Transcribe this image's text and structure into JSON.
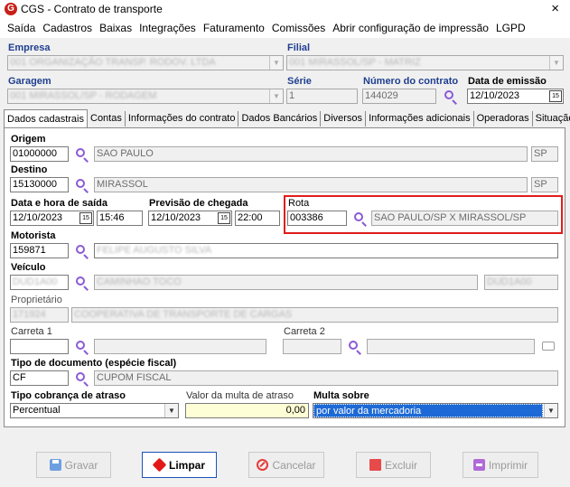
{
  "window": {
    "title": "CGS - Contrato de transporte",
    "close_glyph": "×",
    "logo_letter": "G"
  },
  "menu": [
    "Saída",
    "Cadastros",
    "Baixas",
    "Integrações",
    "Faturamento",
    "Comissões",
    "Abrir configuração de impressão",
    "LGPD"
  ],
  "header": {
    "empresa_label": "Empresa",
    "empresa_value": "001 ORGANIZAÇÃO TRANSP. RODOV. LTDA",
    "filial_label": "Filial",
    "filial_value": "001 MIRASSOL/SP - MATRIZ",
    "garagem_label": "Garagem",
    "garagem_value": "001 MIRASSOL/SP - RODAGEM",
    "serie_label": "Série",
    "serie_value": "1",
    "numero_label": "Número do contrato",
    "numero_value": "144029",
    "emissao_label": "Data de emissão",
    "emissao_value": "12/10/2023"
  },
  "tabs": [
    "Dados cadastrais",
    "Contas",
    "Informações do contrato",
    "Dados Bancários",
    "Diversos",
    "Informações adicionais",
    "Operadoras",
    "Situação"
  ],
  "form": {
    "origem_label": "Origem",
    "origem_code": "01000000",
    "origem_city": "SAO PAULO",
    "origem_uf": "SP",
    "destino_label": "Destino",
    "destino_code": "15130000",
    "destino_city": "MIRASSOL",
    "destino_uf": "SP",
    "saida_label": "Data e hora de saída",
    "saida_date": "12/10/2023",
    "saida_time": "15:46",
    "chegada_label": "Previsão de chegada",
    "chegada_date": "12/10/2023",
    "chegada_time": "22:00",
    "rota_label": "Rota",
    "rota_code": "003386",
    "rota_desc": "SAO PAULO/SP X MIRASSOL/SP",
    "motorista_label": "Motorista",
    "motorista_code": "159871",
    "motorista_name": "FELIPE AUGUSTO SILVA",
    "veiculo_label": "Veículo",
    "veiculo_plate": "DUD1A00",
    "veiculo_desc": "CAMINHAO TOCO",
    "veiculo_extra": "DUD1A00",
    "proprietario_label": "Proprietário",
    "proprietario_code": "171924",
    "proprietario_name": "COOPERATIVA DE TRANSPORTE DE CARGAS",
    "carreta1_label": "Carreta 1",
    "carreta2_label": "Carreta 2",
    "tipo_doc_label": "Tipo de documento (espécie fiscal)",
    "tipo_doc_code": "CF",
    "tipo_doc_desc": "CUPOM FISCAL",
    "cobranca_label": "Tipo cobrança de atraso",
    "cobranca_value": "Percentual",
    "multa_valor_label": "Valor da multa de atraso",
    "multa_valor_value": "0,00",
    "multa_sobre_label": "Multa sobre",
    "multa_sobre_value": "por valor da mercadoria"
  },
  "buttons": {
    "gravar": "Gravar",
    "limpar": "Limpar",
    "cancelar": "Cancelar",
    "excluir": "Excluir",
    "imprimir": "Imprimir"
  },
  "colors": {
    "label_blue": "#1f3f8f",
    "highlight_red": "#e01c1c",
    "accent_blue": "#1d6ad6",
    "search_purple": "#8a5ad8"
  }
}
